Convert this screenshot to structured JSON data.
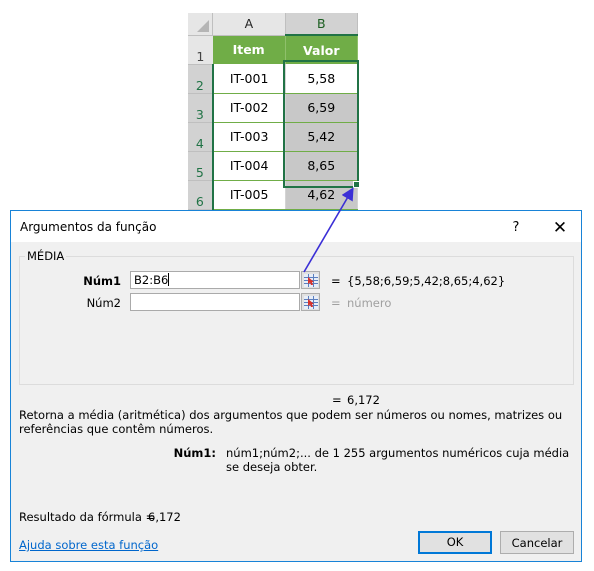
{
  "spreadsheet": {
    "column_headers": [
      "A",
      "B"
    ],
    "row_numbers": [
      "1",
      "2",
      "3",
      "4",
      "5",
      "6"
    ],
    "header_row": [
      "Item",
      "Valor"
    ],
    "rows": [
      {
        "item": "IT-001",
        "valor": "5,58"
      },
      {
        "item": "IT-002",
        "valor": "6,59"
      },
      {
        "item": "IT-003",
        "valor": "5,42"
      },
      {
        "item": "IT-004",
        "valor": "8,65"
      },
      {
        "item": "IT-005",
        "valor": "4,62"
      }
    ],
    "selected_range": "B2:B6",
    "colors": {
      "header_fill": "#70ad47",
      "selection_border": "#217346",
      "selected_fill": "#c8c8c8",
      "arrow": "#3b2fd6"
    }
  },
  "dialog": {
    "title": "Argumentos da função",
    "help_button": "?",
    "close_button": "✕",
    "function_name": "MÉDIA",
    "arguments": [
      {
        "label": "Núm1",
        "value": "B2:B6",
        "preview": "{5,58;6,59;5,42;8,65;4,62}",
        "bold": true
      },
      {
        "label": "Núm2",
        "value": "",
        "preview": "número",
        "bold": false
      }
    ],
    "equals": "=",
    "result_preview": "6,172",
    "description": "Retorna a média (aritmética) dos argumentos que podem ser números ou nomes, matrizes ou referências que contêm números.",
    "arg_help_label": "Núm1:",
    "arg_help_text": "núm1;núm2;... de 1 255 argumentos numéricos cuja média se deseja obter.",
    "formula_result_label": "Resultado da fórmula =",
    "formula_result_value": "6,172",
    "help_link": "Ajuda sobre esta função",
    "ok_label": "OK",
    "cancel_label": "Cancelar",
    "accent_color": "#0078d7"
  }
}
